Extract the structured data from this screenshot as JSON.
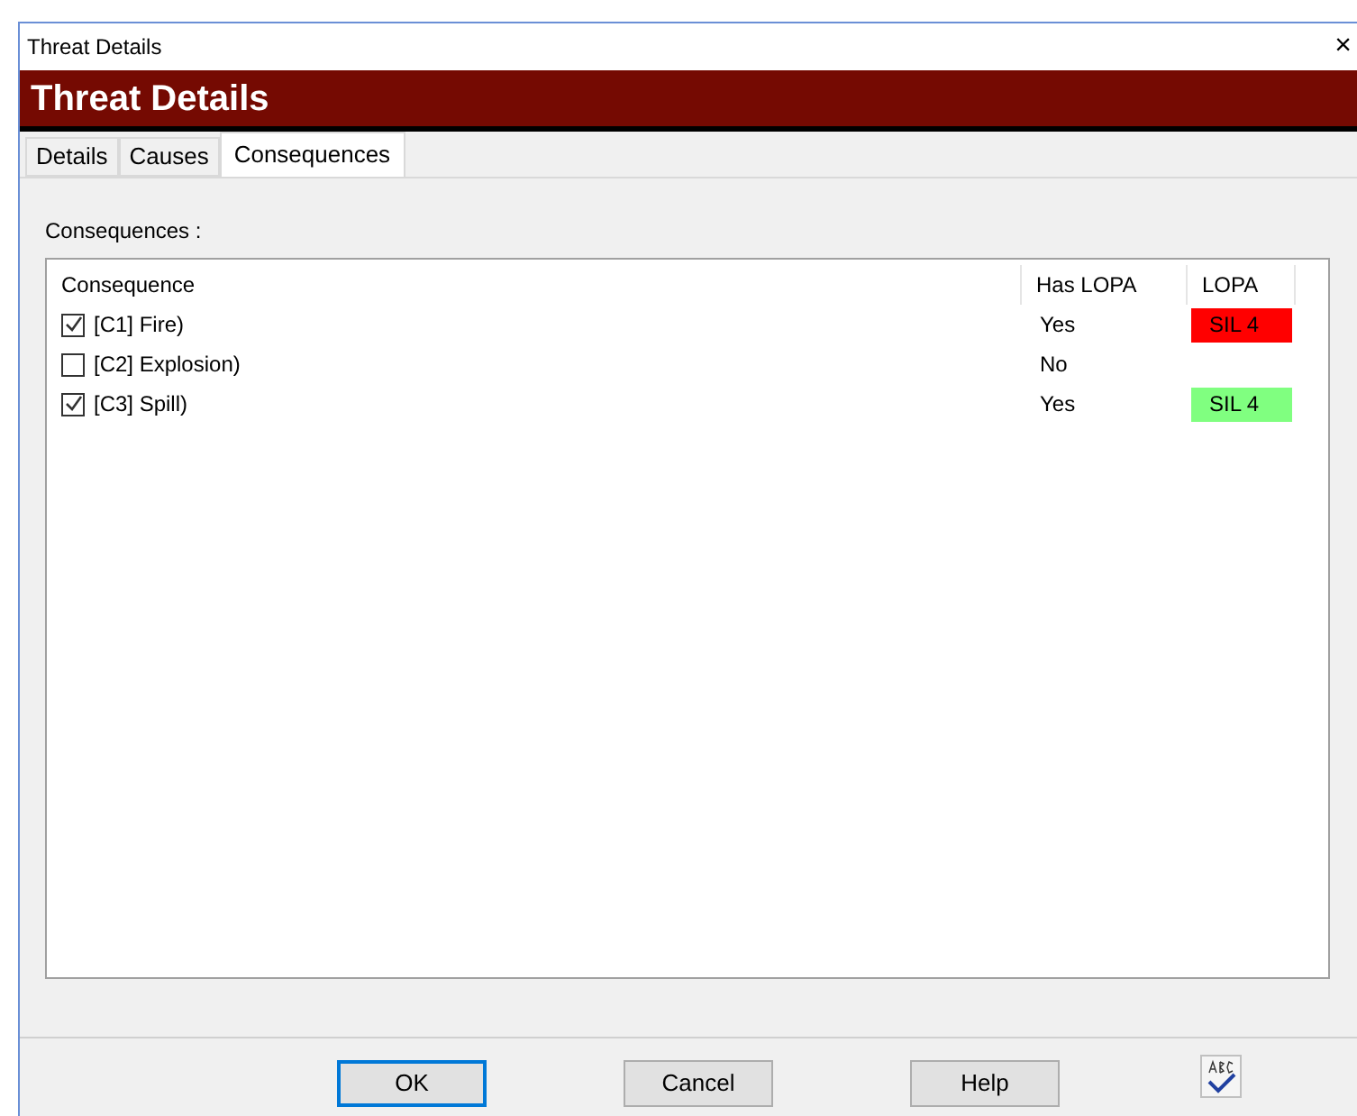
{
  "window": {
    "title": "Threat Details",
    "close": "×"
  },
  "banner": "Threat Details",
  "tabs": [
    {
      "label": "Details",
      "selected": false
    },
    {
      "label": "Causes",
      "selected": false
    },
    {
      "label": "Consequences",
      "selected": true
    }
  ],
  "list_label": "Consequences :",
  "table": {
    "columns": [
      "Consequence",
      "Has LOPA",
      "LOPA"
    ],
    "rows": [
      {
        "consequence": "[C1] Fire)",
        "checked": true,
        "has_lopa": "Yes",
        "lopa": "SIL 4",
        "color": "#ff0000"
      },
      {
        "consequence": "[C2] Explosion)",
        "checked": false,
        "has_lopa": "No"
      },
      {
        "consequence": "[C3] Spill)",
        "checked": true,
        "has_lopa": "Yes",
        "lopa": "SIL 4",
        "color": "#80ff80"
      }
    ]
  },
  "buttons": [
    {
      "label": "OK",
      "default": true
    },
    {
      "label": "Cancel",
      "default": false
    },
    {
      "label": "Help",
      "default": false
    }
  ]
}
